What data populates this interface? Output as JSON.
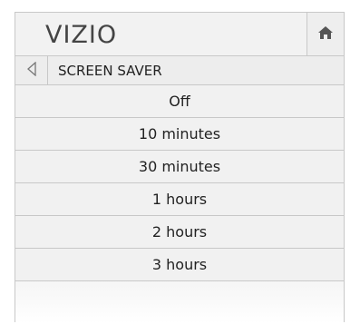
{
  "header": {
    "logo_text": "VIZIO",
    "home_icon": "home-icon"
  },
  "menu": {
    "title": "SCREEN SAVER",
    "back_icon": "back-arrow-icon",
    "options": [
      {
        "label": "Off"
      },
      {
        "label": "10 minutes"
      },
      {
        "label": "30 minutes"
      },
      {
        "label": "1 hours"
      },
      {
        "label": "2 hours"
      },
      {
        "label": "3 hours"
      }
    ]
  },
  "colors": {
    "text": "#222222",
    "border": "#c8c8c8",
    "panel": "#f1f1f1"
  }
}
